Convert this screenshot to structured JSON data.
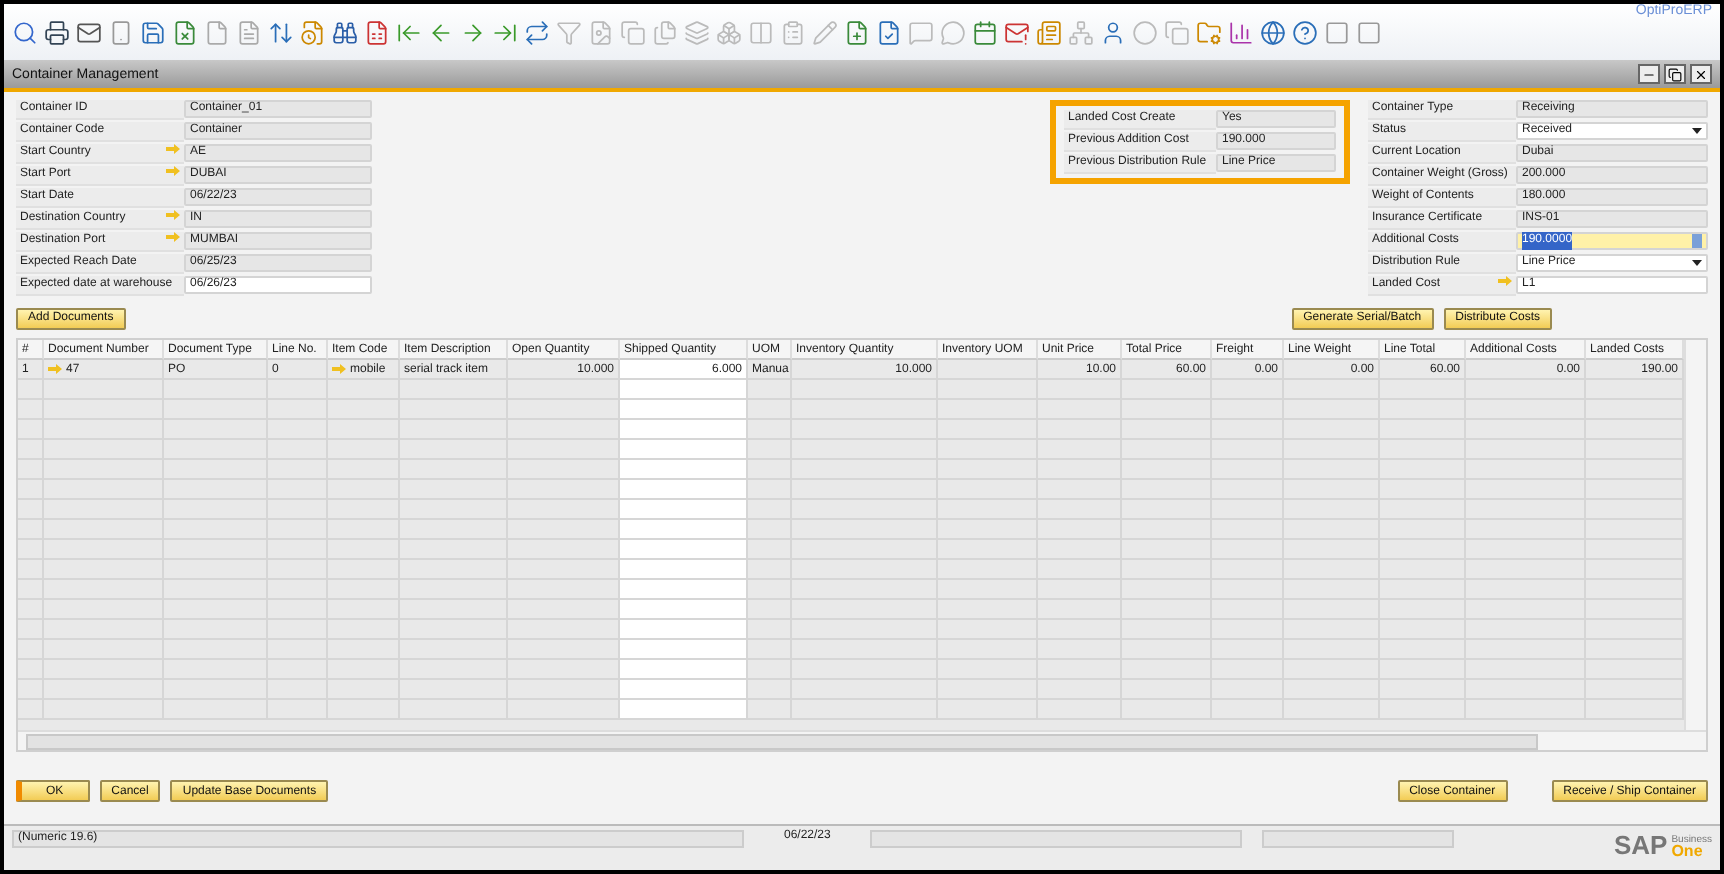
{
  "brand": "OptiProERP",
  "window": {
    "title": "Container Management"
  },
  "left_fields": [
    {
      "label": "Container ID",
      "value": "Container_01",
      "link": false,
      "editable": false
    },
    {
      "label": "Container Code",
      "value": "Container",
      "link": false,
      "editable": false
    },
    {
      "label": "Start Country",
      "value": "AE",
      "link": true,
      "editable": false
    },
    {
      "label": "Start Port",
      "value": "DUBAI",
      "link": true,
      "editable": false
    },
    {
      "label": "Start Date",
      "value": "06/22/23",
      "link": false,
      "editable": false
    },
    {
      "label": "Destination Country",
      "value": "IN",
      "link": true,
      "editable": false
    },
    {
      "label": "Destination Port",
      "value": "MUMBAI",
      "link": true,
      "editable": false
    },
    {
      "label": "Expected Reach Date",
      "value": "06/25/23",
      "link": false,
      "editable": false
    },
    {
      "label": "Expected date at warehouse",
      "value": "06/26/23",
      "link": false,
      "editable": true
    }
  ],
  "landed_cost_panel": [
    {
      "label": "Landed Cost Create",
      "value": "Yes"
    },
    {
      "label": "Previous Addition Cost",
      "value": "190.000"
    },
    {
      "label": "Previous Distribution Rule",
      "value": "Line Price"
    }
  ],
  "right_fields": [
    {
      "label": "Container Type",
      "value": "Receiving",
      "kind": "readonly",
      "link": false
    },
    {
      "label": "Status",
      "value": "Received",
      "kind": "dropdown",
      "link": false
    },
    {
      "label": "Current Location",
      "value": "Dubai",
      "kind": "readonly",
      "link": false
    },
    {
      "label": "Container Weight (Gross)",
      "value": "200.000",
      "kind": "readonly",
      "link": false
    },
    {
      "label": "Weight of Contents",
      "value": "180.000",
      "kind": "readonly",
      "link": false
    },
    {
      "label": "Insurance Certificate",
      "value": "INS-01",
      "kind": "readonly",
      "link": false
    },
    {
      "label": "Additional Costs",
      "value": "190.0000",
      "kind": "focused",
      "link": false
    },
    {
      "label": "Distribution Rule",
      "value": "Line Price",
      "kind": "dropdown",
      "link": false
    },
    {
      "label": "Landed Cost",
      "value": "L1",
      "kind": "input",
      "link": true
    }
  ],
  "top_left_buttons": [
    "Add Documents"
  ],
  "top_right_buttons": [
    "Generate Serial/Batch",
    "Distribute Costs"
  ],
  "table": {
    "columns": [
      {
        "label": "#",
        "numeric": false,
        "editable": false
      },
      {
        "label": "Document Number",
        "numeric": false,
        "editable": false
      },
      {
        "label": "Document Type",
        "numeric": false,
        "editable": false
      },
      {
        "label": "Line No.",
        "numeric": false,
        "editable": false
      },
      {
        "label": "Item Code",
        "numeric": false,
        "editable": false
      },
      {
        "label": "Item Description",
        "numeric": false,
        "editable": false
      },
      {
        "label": "Open Quantity",
        "numeric": true,
        "editable": false
      },
      {
        "label": "Shipped Quantity",
        "numeric": true,
        "editable": true
      },
      {
        "label": "UOM",
        "numeric": false,
        "editable": false
      },
      {
        "label": "Inventory Quantity",
        "numeric": true,
        "editable": false
      },
      {
        "label": "Inventory UOM",
        "editable": false
      },
      {
        "label": "Unit Price",
        "numeric": true,
        "editable": false
      },
      {
        "label": "Total Price",
        "numeric": true,
        "editable": false
      },
      {
        "label": "Freight",
        "numeric": true,
        "editable": false
      },
      {
        "label": "Line Weight",
        "numeric": true,
        "editable": false
      },
      {
        "label": "Line Total",
        "numeric": true,
        "editable": false
      },
      {
        "label": "Additional Costs",
        "numeric": true,
        "editable": false
      },
      {
        "label": "Landed Costs",
        "numeric": true,
        "editable": false
      }
    ],
    "rows": [
      {
        "cells": [
          {
            "text": "1"
          },
          {
            "text": "47",
            "link": true
          },
          {
            "text": "PO"
          },
          {
            "text": "0"
          },
          {
            "text": "mobile",
            "link": true
          },
          {
            "text": "serial track item"
          },
          {
            "text": "10.000"
          },
          {
            "text": "6.000"
          },
          {
            "text": "Manua"
          },
          {
            "text": "10.000"
          },
          {},
          {
            "text": "10.00"
          },
          {
            "text": "60.00"
          },
          {
            "text": "0.00"
          },
          {
            "text": "0.00"
          },
          {
            "text": "60.00"
          },
          {
            "text": "0.00"
          },
          {
            "text": "190.00"
          }
        ]
      }
    ]
  },
  "bottom_left_buttons": [
    {
      "label": "OK",
      "primary": true
    },
    {
      "label": "Cancel",
      "primary": false
    },
    {
      "label": "Update Base Documents",
      "primary": false
    }
  ],
  "bottom_right_buttons": [
    "Close Container",
    "Receive / Ship Container"
  ],
  "status_bar": {
    "message": "(Numeric 19.6)",
    "date": "06/22/23"
  },
  "logo": {
    "name": "SAP",
    "line1": "Business",
    "line2": "One"
  }
}
